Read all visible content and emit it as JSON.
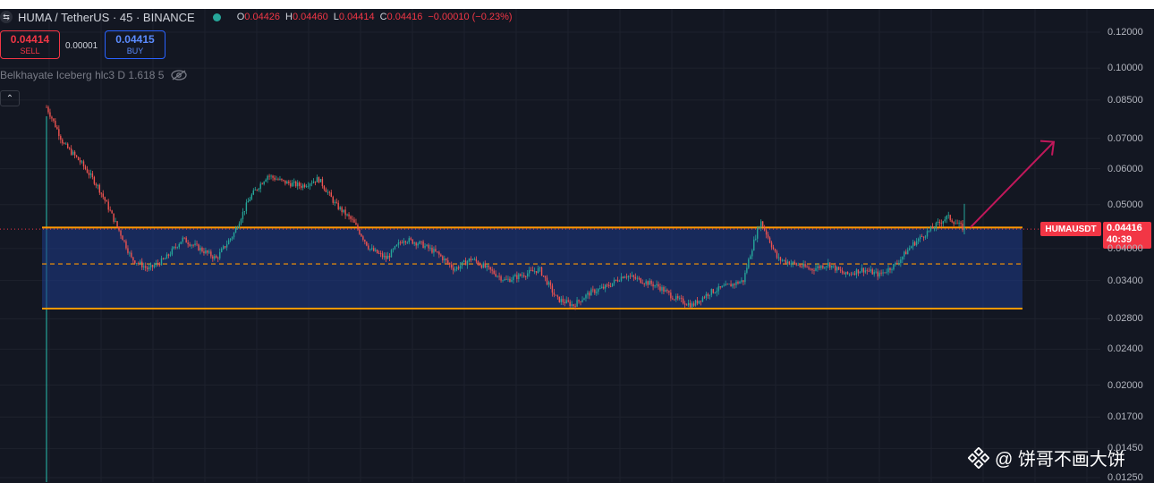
{
  "legend": {
    "symbol_icon": "exchange-icon",
    "symbol": "HUMA / TetherUS · 45 · BINANCE",
    "open_key": "O",
    "open": "0.04426",
    "high_key": "H",
    "high": "0.04460",
    "low_key": "L",
    "low": "0.04414",
    "close_key": "C",
    "close": "0.04416",
    "change": "−0.00010 (−0.23%)"
  },
  "trade": {
    "sell_price": "0.04414",
    "sell_label": "SELL",
    "spread": "0.00001",
    "buy_price": "0.04415",
    "buy_label": "BUY"
  },
  "indicator": {
    "label": "Belkhayate Iceberg hlc3 D 1.618 5"
  },
  "collapse_label": "⌃",
  "price_tag": {
    "symbol": "HUMAUSDT",
    "price": "0.04416",
    "countdown": "40:39"
  },
  "watermark": {
    "text": "@ 饼哥不画大饼"
  },
  "colors": {
    "background": "#131722",
    "up": "#26a69a",
    "down": "#ef5350",
    "channel_fill": "#1e3a8a",
    "channel_border": "#ff9800",
    "arrow": "#c2185b"
  },
  "chart_data": {
    "type": "candlestick",
    "symbol": "HUMA / TetherUS",
    "interval": "45",
    "exchange": "BINANCE",
    "y_scale": "log",
    "ylim": [
      0.0125,
      0.125
    ],
    "y_ticks": [
      "0.12000",
      "0.10000",
      "0.08500",
      "0.07000",
      "0.06000",
      "0.05000",
      "0.04000",
      "0.03400",
      "0.02800",
      "0.02400",
      "0.02000",
      "0.01700",
      "0.01450",
      "0.01250"
    ],
    "price_path": [
      0.082,
      0.068,
      0.062,
      0.055,
      0.046,
      0.038,
      0.036,
      0.038,
      0.042,
      0.04,
      0.038,
      0.043,
      0.052,
      0.058,
      0.056,
      0.055,
      0.057,
      0.05,
      0.046,
      0.04,
      0.038,
      0.042,
      0.041,
      0.039,
      0.036,
      0.038,
      0.036,
      0.034,
      0.035,
      0.036,
      0.031,
      0.03,
      0.032,
      0.033,
      0.035,
      0.034,
      0.033,
      0.031,
      0.03,
      0.032,
      0.033,
      0.034,
      0.046,
      0.038,
      0.037,
      0.036,
      0.037,
      0.035,
      0.036,
      0.035,
      0.037,
      0.041,
      0.044,
      0.047,
      0.04416
    ],
    "channel": {
      "upper": 0.0445,
      "middle": 0.037,
      "lower": 0.0295
    },
    "projection_target": 0.07,
    "last_price": 0.04416
  }
}
